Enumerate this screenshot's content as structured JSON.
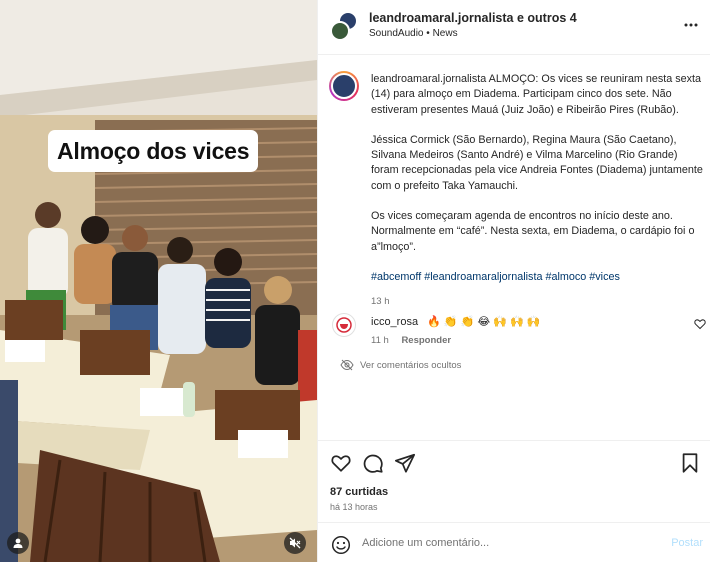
{
  "media": {
    "overlay_text": "Almoço dos vices",
    "icons": [
      "user-tag-icon",
      "mute-icon"
    ]
  },
  "header": {
    "title": "leandroamaral.jornalista e outros 4",
    "audio": "SoundAudio",
    "separator": "•",
    "category": "News",
    "more_icon": "more-options-icon"
  },
  "caption": {
    "username": "leandroamaral.jornalista",
    "paragraph1": "ALMOÇO: Os vices se reuniram nesta sexta (14) para almoço em Diadema. Participam cinco dos sete. Não estiveram presentes Mauá (Juiz João) e Ribeirão Pires (Rubão).",
    "paragraph2": "Jéssica Cormick (São Bernardo), Regina Maura (São Caetano), Silvana Medeiros (Santo André) e Vilma Marcelino (Rio Grande) foram recepcionadas pela vice Andreia Fontes (Diadema) juntamente com o prefeito Taka Yamauchi.",
    "paragraph3": "Os vices começaram agenda de encontros no início deste ano. Normalmente em “café”. Nesta sexta, em Diadema, o cardápio foi o a”lmoço”.",
    "hashtags": "#abcemoff #leandroamaraljornalista #almoco #vices",
    "timestamp": "13 h"
  },
  "comments": [
    {
      "username": "icco_rosa",
      "text": "🔥 👏 👏 😂 🙌 🙌 🙌",
      "time": "11 h",
      "reply_label": "Responder"
    }
  ],
  "hidden_comments_label": "Ver comentários ocultos",
  "actions": {
    "likes": "87 curtidas",
    "posted": "há 13 horas"
  },
  "add_comment": {
    "placeholder": "Adicione um comentário...",
    "post_label": "Postar"
  },
  "colors": {
    "link": "#00376b",
    "muted": "#737373",
    "post_disabled": "#b2dffc"
  }
}
